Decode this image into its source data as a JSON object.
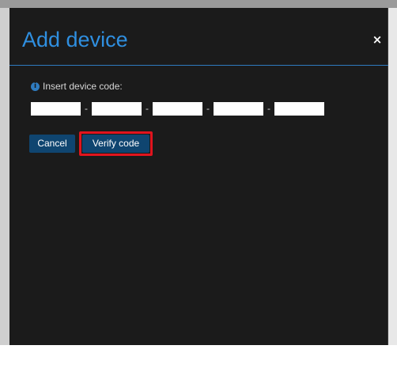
{
  "modal": {
    "title": "Add device",
    "close_glyph": "×",
    "prompt_label": "Insert device code:",
    "info_icon": "info-icon",
    "info_glyph": "i",
    "code_fields": [
      {
        "value": "",
        "placeholder": ""
      },
      {
        "value": "",
        "placeholder": ""
      },
      {
        "value": "",
        "placeholder": ""
      },
      {
        "value": "",
        "placeholder": ""
      },
      {
        "value": "",
        "placeholder": ""
      }
    ],
    "separator": "-",
    "cancel_label": "Cancel",
    "verify_label": "Verify code"
  },
  "colors": {
    "modal_background": "#1b1b1b",
    "title": "#2f8fe0",
    "header_divider": "#2e7bc0",
    "button_background": "#0f4570",
    "highlight": "#e0141e"
  }
}
